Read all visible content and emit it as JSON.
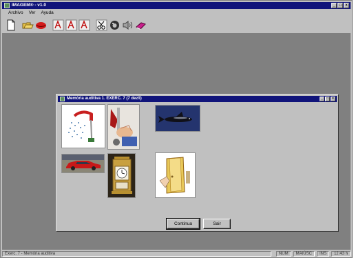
{
  "app": {
    "title": "IMAGEM® - v1.0"
  },
  "menu": {
    "items": [
      "Archivo",
      "Ver",
      "Ayuda"
    ]
  },
  "toolbar": {
    "icons": [
      "new-file-icon",
      "open-folder-icon",
      "lips-icon",
      "spelling-a-icon",
      "spelling-a-icon",
      "spelling-a-icon",
      "scissors-icon",
      "pig-icon",
      "audio-icon",
      "book-icon"
    ]
  },
  "child_window": {
    "title": "Memória auditiva 1. EXERC. 7 (7 dez/l)",
    "buttons": {
      "continue": "Continua",
      "exit": "Sair"
    },
    "cards": [
      "shower-image",
      "hand-on-lever-image",
      "fish-image",
      "red-car-image",
      "clock-image",
      "door-image"
    ]
  },
  "status": {
    "main_text": "Exerc. 7 - Memória auditiva",
    "cells": [
      "NUM",
      "MAIÚSC",
      "INS",
      "12:43 h"
    ]
  },
  "colors": {
    "titlebar": "#10147a",
    "face": "#c0c0c0",
    "workspace": "#808080"
  }
}
